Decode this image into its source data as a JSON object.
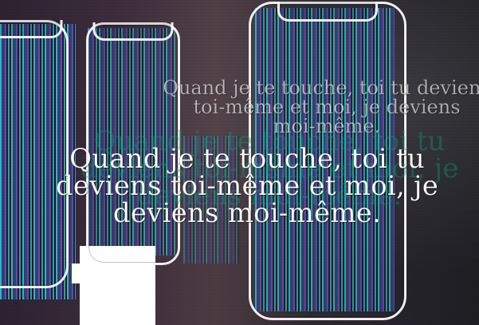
{
  "caption": {
    "main": "Quand je te touche, toi tu\ndeviens toi-même et moi, je\ndeviens moi-même.",
    "echo": "Quand je te touche, toi tu deviens\ntoi-même et moi, je deviens\nmoi-même."
  },
  "colors": {
    "glitch_cyan": "#1bd6e6",
    "glitch_purple": "#8c3ad8",
    "background_dark": "#1b1b22",
    "outline_white": "#ffffff"
  },
  "icons": {
    "phone_outline": "phone-outline-icon"
  }
}
